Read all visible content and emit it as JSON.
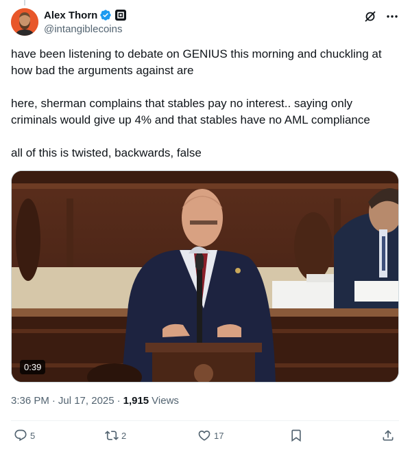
{
  "author": {
    "display_name": "Alex Thorn",
    "handle": "@intangiblecoins",
    "verified": true
  },
  "header_icons": [
    "grok-icon",
    "more-icon"
  ],
  "tweet": {
    "paragraphs": [
      "have been listening to debate on GENIUS this morning and chuckling at how bad the arguments against are",
      "here, sherman complains that stables pay no interest.. saying only criminals would give up 4% and that stables have no AML compliance",
      "all of this is twisted, backwards, false"
    ]
  },
  "media": {
    "type": "video",
    "duration": "0:39"
  },
  "meta": {
    "time": "3:36 PM",
    "separator": "·",
    "date": "Jul 17, 2025",
    "views_count": "1,915",
    "views_label": "Views"
  },
  "actions": {
    "replies": "5",
    "reposts": "2",
    "likes": "17"
  },
  "colors": {
    "text": "#0f1419",
    "secondary": "#536471",
    "verified_blue": "#1d9bf0",
    "divider": "#eff3f4"
  }
}
